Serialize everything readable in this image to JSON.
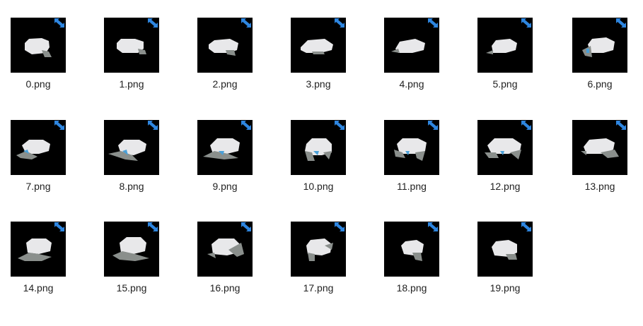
{
  "files": [
    {
      "name": "0.png"
    },
    {
      "name": "1.png"
    },
    {
      "name": "2.png"
    },
    {
      "name": "3.png"
    },
    {
      "name": "4.png"
    },
    {
      "name": "5.png"
    },
    {
      "name": "6.png"
    },
    {
      "name": "7.png"
    },
    {
      "name": "8.png"
    },
    {
      "name": "9.png"
    },
    {
      "name": "10.png"
    },
    {
      "name": "11.png"
    },
    {
      "name": "12.png"
    },
    {
      "name": "13.png"
    },
    {
      "name": "14.png"
    },
    {
      "name": "15.png"
    },
    {
      "name": "16.png"
    },
    {
      "name": "17.png"
    },
    {
      "name": "18.png"
    },
    {
      "name": "19.png"
    }
  ],
  "badge_icon": "pin-badge-icon",
  "colors": {
    "thumb_bg": "#000000",
    "object": "#e8e8ea",
    "shadow": "#8a8f8c",
    "badge": "#2e86e0",
    "label": "#222222"
  }
}
